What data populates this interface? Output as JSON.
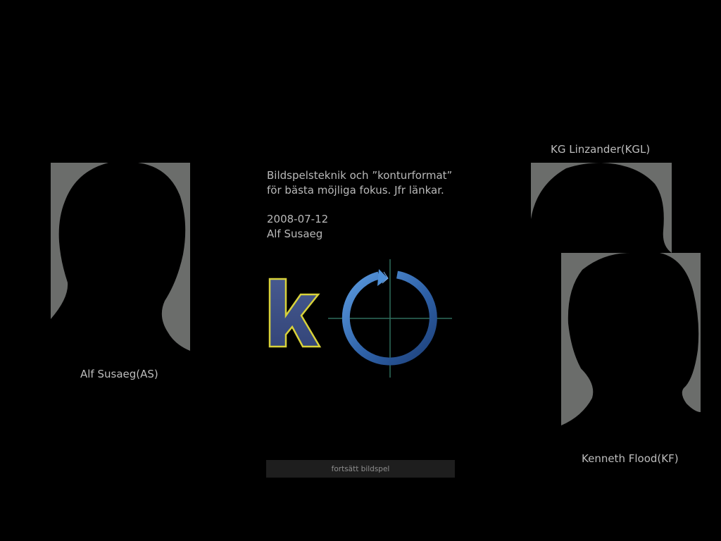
{
  "slideshow": {
    "description_line1": "Bildspelsteknik och ”konturformat”",
    "description_line2": "för bästa möjliga fokus. Jfr länkar.",
    "date": "2008-07-12",
    "author": "Alf Susaeg",
    "continue_label": "fortsätt bildspel"
  },
  "people": {
    "left": {
      "name": "Alf Susaeg(AS)"
    },
    "top_right": {
      "name": "KG Linzander(KGL)"
    },
    "bottom_right": {
      "name": "Kenneth Flood(KF)"
    }
  },
  "logo": {
    "letter": "k",
    "letter_fill": "#3b4f86",
    "letter_outline": "#d8d23a",
    "ring_color": "#3a72b8",
    "crosshair_color": "#2f6e5c"
  },
  "colors": {
    "background": "#000000",
    "portrait_frame": "#6b6d6b",
    "silhouette": "#000000"
  }
}
